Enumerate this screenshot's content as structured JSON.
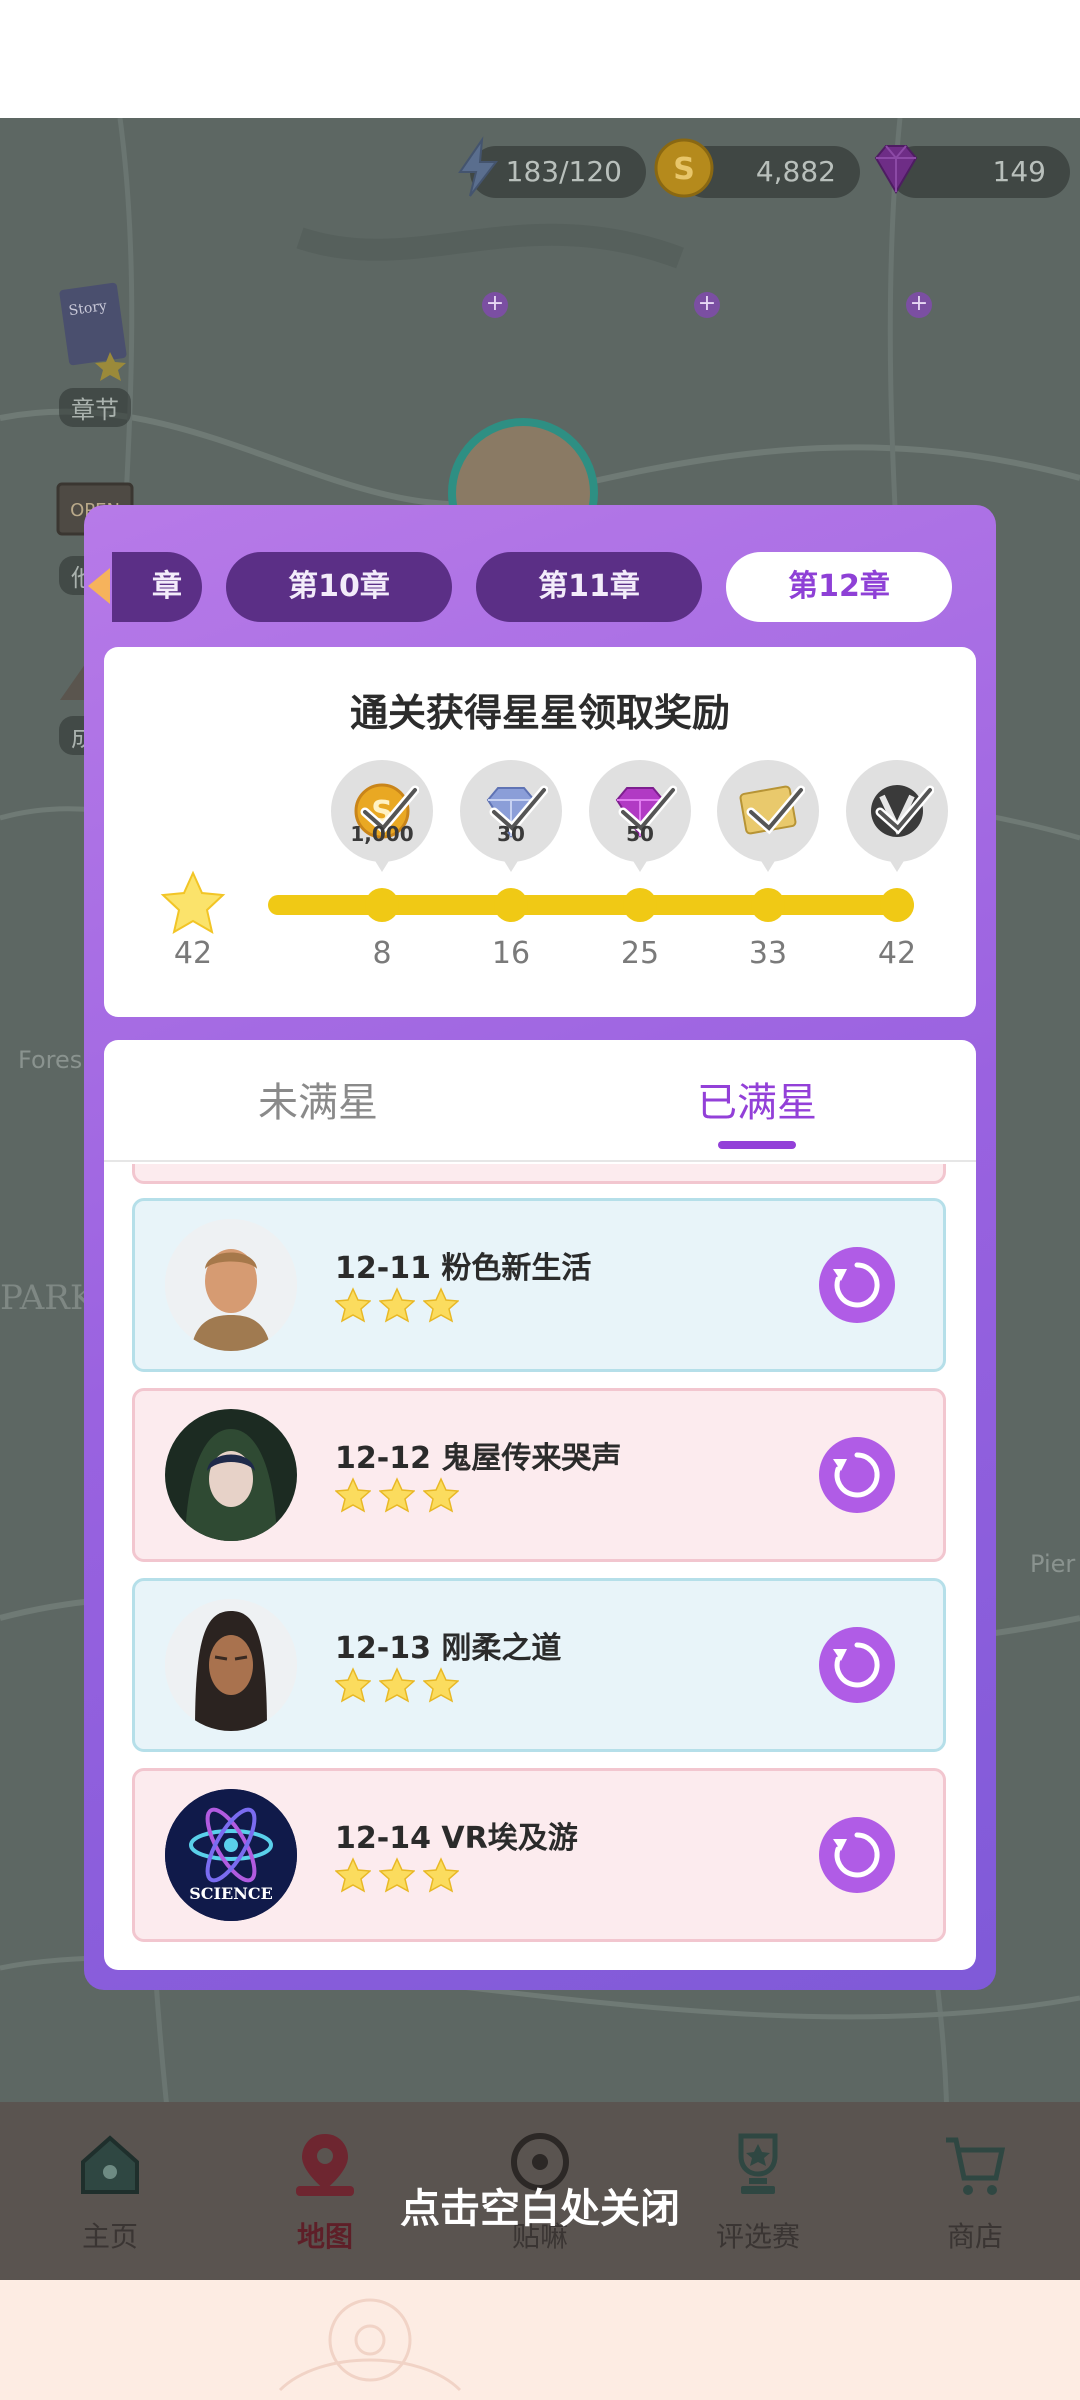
{
  "resources": {
    "energy": "183/120",
    "coins": "4,882",
    "gems": "149"
  },
  "side_menu": {
    "chapter_label": "章节",
    "other_label": "他们",
    "achieve_label": "成长"
  },
  "map_labels": {
    "forest": "Fores",
    "park": "PARK",
    "pier": "Pier"
  },
  "chapter_tabs": [
    {
      "label": "章"
    },
    {
      "label": "第10章"
    },
    {
      "label": "第11章"
    },
    {
      "label": "第12章",
      "active": true
    }
  ],
  "rewards_panel": {
    "title": "通关获得星星领取奖励",
    "total_stars": "42",
    "milestones": [
      {
        "stars": "8",
        "amount": "1,000",
        "item": "coin-icon"
      },
      {
        "stars": "16",
        "amount": "30",
        "item": "diamond-icon"
      },
      {
        "stars": "25",
        "amount": "50",
        "item": "gem-icon"
      },
      {
        "stars": "33",
        "amount": "",
        "item": "card-icon"
      },
      {
        "stars": "42",
        "amount": "",
        "item": "v-badge-icon"
      }
    ]
  },
  "list_tabs": {
    "not_full": "未满星",
    "full": "已满星"
  },
  "levels": [
    {
      "title": "12-11 粉色新生活",
      "stars": 3,
      "theme": "blue"
    },
    {
      "title": "12-12 鬼屋传来哭声",
      "stars": 3,
      "theme": "pink"
    },
    {
      "title": "12-13 刚柔之道",
      "stars": 3,
      "theme": "blue"
    },
    {
      "title": "12-14 VR埃及游",
      "stars": 3,
      "theme": "pink",
      "avatar_text": "SCIENCE"
    }
  ],
  "bottom_nav": [
    {
      "label": "主页",
      "icon": "home-icon"
    },
    {
      "label": "地图",
      "icon": "map-pin-icon"
    },
    {
      "label": "贴嘛",
      "icon": "chat-icon"
    },
    {
      "label": "评选赛",
      "icon": "trophy-icon"
    },
    {
      "label": "商店",
      "icon": "cart-icon"
    }
  ],
  "close_hint": "点击空白处关闭",
  "colors": {
    "accent": "#9340d8",
    "modal_gradient": [
      "#b77ae8",
      "#7f5ad8"
    ],
    "progress": "#f0c915",
    "replay": "#b05ce6"
  }
}
